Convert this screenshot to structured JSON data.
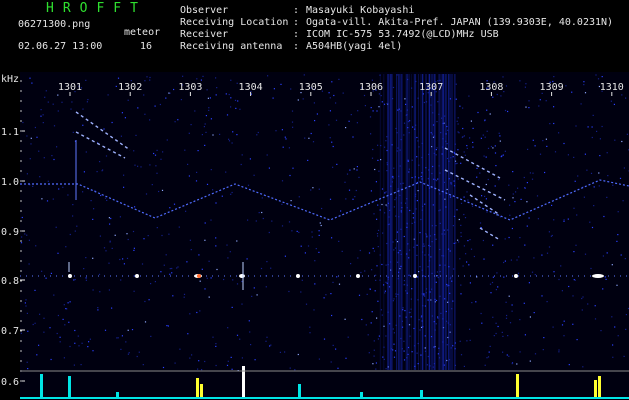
{
  "header": {
    "logo": "HROFFT",
    "filename": "06271300.png",
    "datetime": "02.06.27 13:00",
    "meteor_label": "meteor",
    "meteor_count": "16",
    "info_labels": [
      "Observer",
      "Receiving Location",
      "Receiver",
      "Receiving antenna"
    ],
    "info_colons": [
      ":",
      ":",
      ":",
      ":"
    ],
    "info_values": [
      "Masayuki Kobayashi",
      "Ogata-vill. Akita-Pref. JAPAN (139.9303E, 40.0231N)",
      "ICOM IC-575 53.7492(@LCD)MHz USB",
      "A504HB(yagi 4el)"
    ]
  },
  "spectrogram": {
    "y_unit": "kHz",
    "y_ticks": [
      "1.1",
      "1.0",
      "0.9",
      "0.8",
      "0.7",
      "0.6"
    ],
    "minute_labels": [
      "1301",
      "1302",
      "1303",
      "1304",
      "1305",
      "1306",
      "1307",
      "1308",
      "1309",
      "1310"
    ],
    "colors": {
      "background": "#000010",
      "noise": "#1a2cff",
      "echo": "#ffffff",
      "bars": "#ffff30",
      "baseline": "#00e5e5"
    }
  }
}
